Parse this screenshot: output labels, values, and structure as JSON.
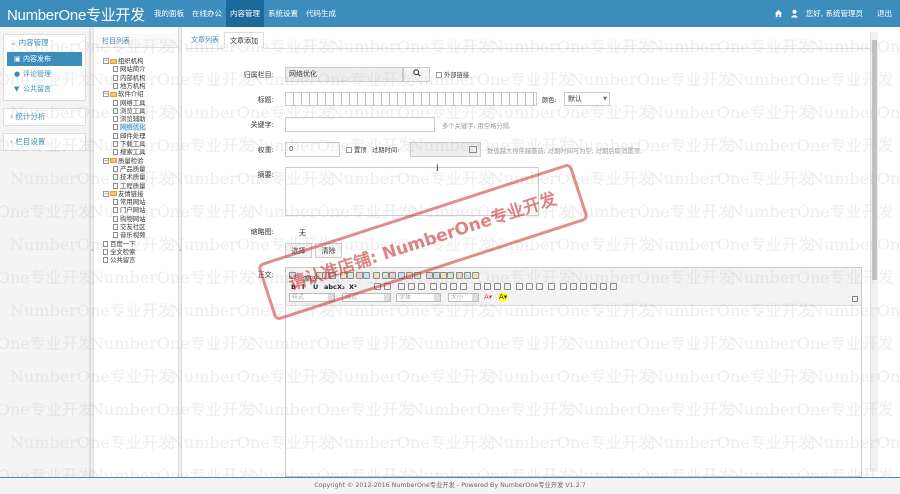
{
  "app": {
    "logo": "NumberOne专业开发"
  },
  "nav": [
    "我的面板",
    "在线办公",
    "内容管理",
    "系统设置",
    "代码生成"
  ],
  "header_right": {
    "greeting": "您好, 系统管理员",
    "logout": "退出"
  },
  "sidebar": {
    "group1": "内容管理",
    "items": [
      "内容发布",
      "评论管理",
      "公共留言"
    ],
    "group2": "统计分析",
    "group3": "栏目设置"
  },
  "tree": {
    "title": "栏目列表",
    "nodes": [
      "组织机构",
      "网站简介",
      "内部机构",
      "地方机构",
      "软件介绍",
      "网络工具",
      "浏览工具",
      "浏览辅助",
      "网络优化",
      "邮件处理",
      "下载工具",
      "搜索工具",
      "质量检验",
      "产品质量",
      "技术质量",
      "工程质量",
      "友情链接",
      "常用网站",
      "门户网站",
      "购物网站",
      "交友社区",
      "音乐视频",
      "百度一下",
      "全文检索",
      "公共留言"
    ]
  },
  "tabs": [
    "文章列表",
    "文章添加"
  ],
  "form": {
    "category_label": "归属栏目:",
    "category_value": "网络优化",
    "external_link": "外部链接",
    "title_label": "标题:",
    "color_label": "颜色:",
    "color_value": "默认",
    "keywords_label": "关键字:",
    "keywords_hint": "多个关键字, 用空格分隔.",
    "weight_label": "权重:",
    "weight_value": "0",
    "top_label": "置顶",
    "expire_label": "过期时间:",
    "expire_hint": "数值越大排序越靠前, 过期时间可为空, 过期后取消置顶.",
    "summary_label": "摘要:",
    "thumb_label": "缩略图:",
    "thumb_value": "无",
    "select_button": "选择",
    "clear_button": "清除",
    "body_label": "正文:"
  },
  "editor": {
    "source_label": "源码",
    "selects": [
      "样式",
      "格式",
      "字体",
      "大小"
    ]
  },
  "watermark": {
    "text": "NumberOne专业开发"
  },
  "stamp": {
    "text": "请认准店铺: NumberOne专业开发"
  },
  "footer": {
    "text": "Copyright © 2012-2016 NumberOne专业开发 - Powered By NumberOne专业开发 V1.2.7"
  }
}
